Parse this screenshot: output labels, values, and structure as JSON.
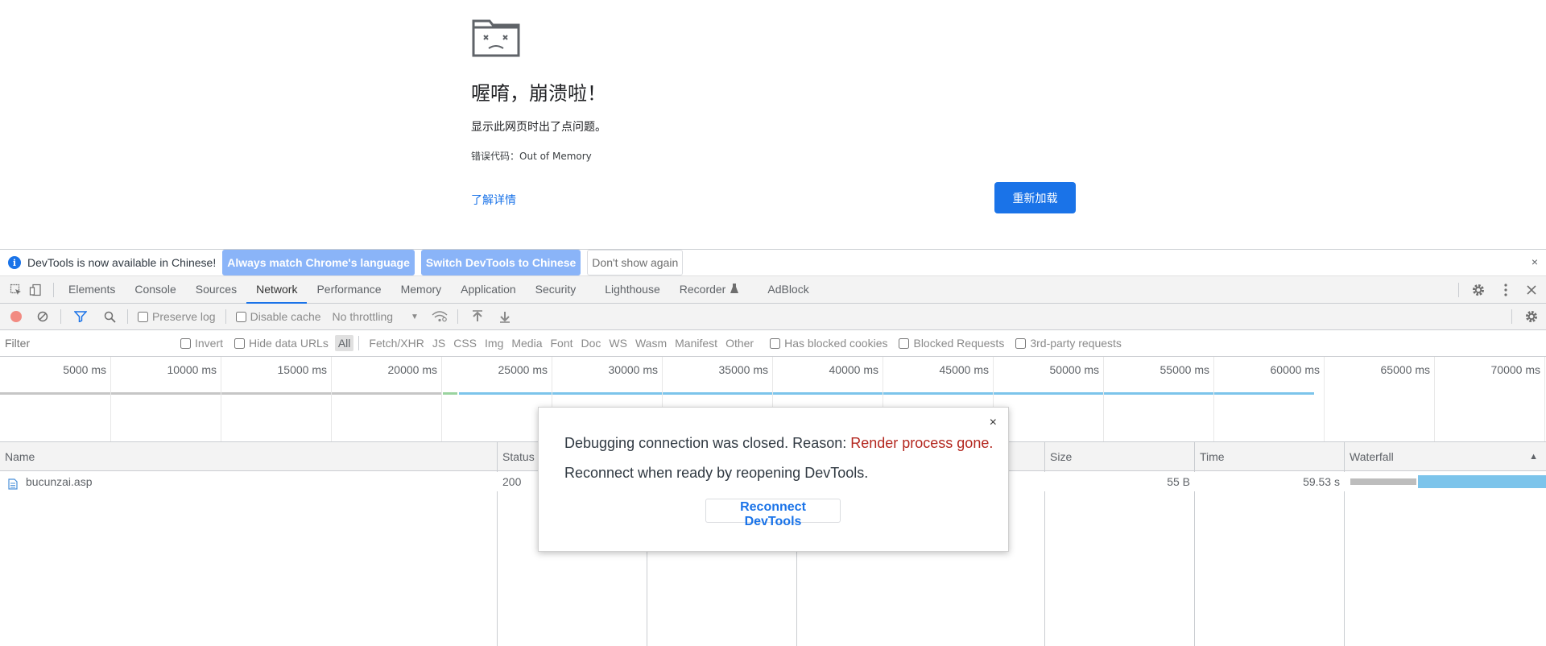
{
  "crash_page": {
    "title": "喔唷，崩溃啦！",
    "description": "显示此网页时出了点问题。",
    "error_label": "错误代码：",
    "error_code": "Out of Memory",
    "learn_more": "了解详情",
    "reload_label": "重新加载",
    "icon": "sad-folder-icon",
    "accent_color": "#1a73e8"
  },
  "infobar": {
    "message": "DevTools is now available in Chinese!",
    "always_match": "Always match Chrome's language",
    "switch_chinese": "Switch DevTools to Chinese",
    "dont_show": "Don't show again",
    "close": "×"
  },
  "tabs": [
    "Elements",
    "Console",
    "Sources",
    "Network",
    "Performance",
    "Memory",
    "Application",
    "Security",
    "Lighthouse",
    "Recorder",
    "AdBlock"
  ],
  "active_tab": "Network",
  "toolbar": {
    "preserve_log": "Preserve log",
    "disable_cache": "Disable cache",
    "throttling": "No throttling",
    "throttle_arrow": "▼"
  },
  "filterbar": {
    "placeholder": "Filter",
    "invert": "Invert",
    "hide_data_urls": "Hide data URLs",
    "types": [
      "All",
      "Fetch/XHR",
      "JS",
      "CSS",
      "Img",
      "Media",
      "Font",
      "Doc",
      "WS",
      "Wasm",
      "Manifest",
      "Other"
    ],
    "active_type": "All",
    "has_blocked_cookies": "Has blocked cookies",
    "blocked_requests": "Blocked Requests",
    "third_party": "3rd-party requests"
  },
  "overview": {
    "ticks": [
      "5000 ms",
      "10000 ms",
      "15000 ms",
      "20000 ms",
      "25000 ms",
      "30000 ms",
      "35000 ms",
      "40000 ms",
      "45000 ms",
      "50000 ms",
      "55000 ms",
      "60000 ms",
      "65000 ms",
      "70000 ms"
    ]
  },
  "table": {
    "headers": {
      "name": "Name",
      "status": "Status",
      "size": "Size",
      "time": "Time",
      "waterfall": "Waterfall",
      "sort_arrow": "▲"
    },
    "rows": [
      {
        "name": "bucunzai.asp",
        "status": "200",
        "size": "55 B",
        "time": "59.53 s"
      }
    ]
  },
  "modal": {
    "message_prefix": "Debugging connection was closed. Reason: ",
    "reason": "Render process gone.",
    "message2": "Reconnect when ready by reopening DevTools.",
    "button": "Reconnect DevTools",
    "close": "×"
  }
}
